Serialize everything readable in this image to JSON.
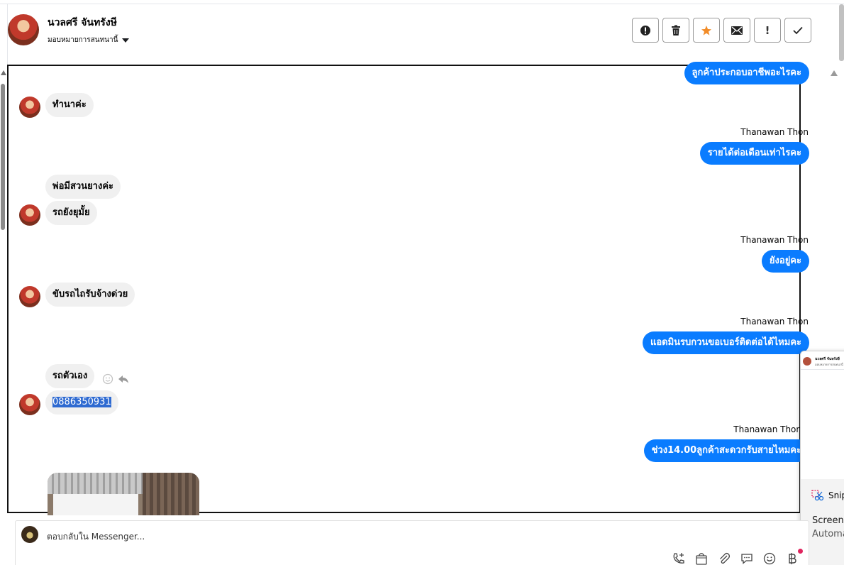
{
  "header": {
    "contact_name": "นวลศรี จันทรังษี",
    "assign_label": "มอบหมายการสนทนานี้",
    "actions": [
      {
        "name": "spam-button",
        "icon": "alert-circle-icon"
      },
      {
        "name": "delete-button",
        "icon": "trash-icon"
      },
      {
        "name": "star-button",
        "icon": "star-icon"
      },
      {
        "name": "mark-unread-button",
        "icon": "envelope-icon"
      },
      {
        "name": "mark-important-button",
        "icon": "exclamation-icon",
        "label": "!"
      },
      {
        "name": "mark-done-button",
        "icon": "check-icon"
      }
    ],
    "star_color": "#f28c28"
  },
  "conversation": {
    "messages": [
      {
        "dir": "out",
        "text": "ลูกค้าประกอบอาชีพอะไรคะ"
      },
      {
        "dir": "in",
        "text": "ทำนาค่ะ"
      },
      {
        "dir": "out",
        "sender": "Thanawan Thon",
        "text": "รายได้ต่อเดือนเท่าไรคะ"
      },
      {
        "dir": "in",
        "text": "พ่อมีสวนยางค่ะ"
      },
      {
        "dir": "in",
        "text": "รถยังยุมั้ย"
      },
      {
        "dir": "out",
        "sender": "Thanawan Thon",
        "text": "ยังอยู่คะ"
      },
      {
        "dir": "in",
        "text": "ขับรถไถรับจ้างด่วย"
      },
      {
        "dir": "out",
        "sender": "Thanawan Thon",
        "text": "แอดมินรบกวนขอเบอร์ติดต่อได้ไหมคะ"
      },
      {
        "dir": "in",
        "text": "รถตัวเอง"
      },
      {
        "dir": "in",
        "text": "0886350931",
        "selected": true
      },
      {
        "dir": "out",
        "sender": "Thanawan Thon",
        "text": "ช่วง14.00ลูกค้าสะดวกรับสายไหมคะ"
      },
      {
        "dir": "in",
        "type": "photo"
      }
    ],
    "outgoing_color": "#0a7cff",
    "incoming_color": "#f0f0f0"
  },
  "popup": {
    "mini_name": "นวลศรี จันทรังษี",
    "mini_sub": "มอบหมายการสนทนานี้",
    "app_label": "Snip",
    "title": "Screens",
    "subtitle": "Automa"
  },
  "composer": {
    "placeholder": "ตอบกลับใน Messenger...",
    "tools": [
      "phone-add-icon",
      "shopping-bag-icon",
      "paperclip-icon",
      "chat-bubble-icon",
      "smiley-icon",
      "baht-icon"
    ]
  }
}
